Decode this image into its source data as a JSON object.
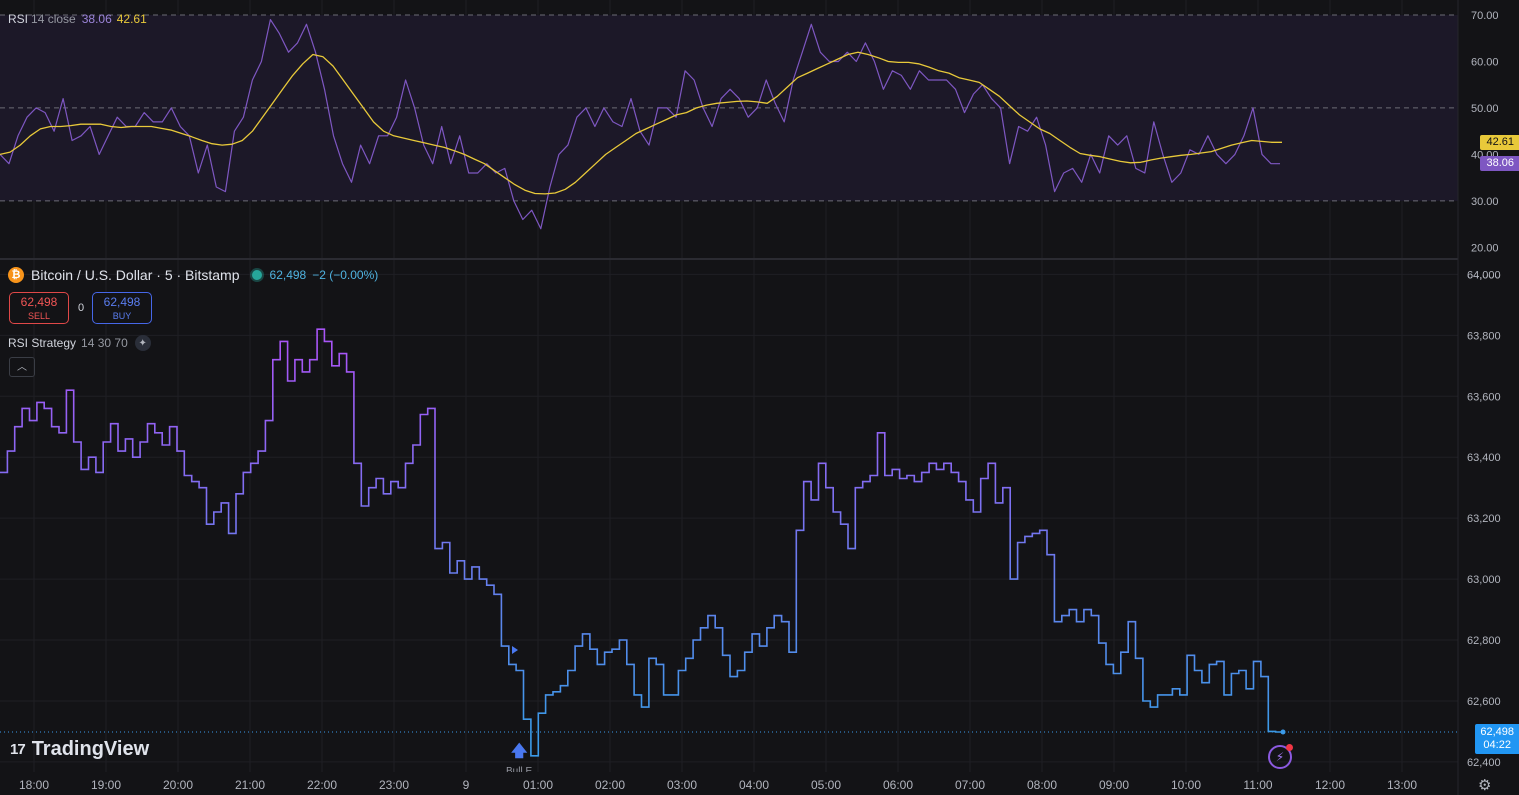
{
  "rsi_legend": {
    "name": "RSI",
    "params": "14 close",
    "rsi_value": "38.06",
    "ma_value": "42.61"
  },
  "symbol": {
    "title": "Bitcoin / U.S. Dollar · 5 · Bitstamp",
    "price": "62,498",
    "change": "−2 (−0.00%)"
  },
  "trade": {
    "sell_price": "62,498",
    "sell_label": "SELL",
    "spread": "0",
    "buy_price": "62,498",
    "buy_label": "BUY"
  },
  "strategy": {
    "name": "RSI Strategy",
    "params": "14 30 70"
  },
  "brand": {
    "name": "TradingView",
    "logo_glyph": "17"
  },
  "signal": {
    "partial_label": "Bull E"
  },
  "price_label": {
    "price": "62,498",
    "countdown": "04:22"
  },
  "icons": {
    "btc": "bitcoin-icon",
    "collapse": "chevron-up-icon",
    "flash": "flash-icon",
    "settings": "gear-icon"
  },
  "colors": {
    "rsi_line": "#7e57c2",
    "rsi_ma": "#e8c93a",
    "price_high": "#a855f7",
    "price_low": "#3b9ae8",
    "rsi_band": "#1c1828"
  },
  "chart_data": [
    {
      "type": "line",
      "title": "RSI",
      "ylim": [
        17.5,
        71.5
      ],
      "ticks": [
        "70.00",
        "60.00",
        "50.00",
        "40.00",
        "30.00",
        "20.00"
      ],
      "bands": [
        30,
        50,
        70
      ],
      "series": [
        {
          "name": "RSI",
          "values": [
            40,
            38,
            44,
            48,
            50,
            49,
            45,
            52,
            43,
            44,
            46,
            40,
            44,
            48,
            46,
            46,
            49,
            47,
            47,
            50,
            46,
            44,
            36,
            42,
            33,
            32,
            45,
            48,
            56,
            60,
            69,
            66,
            62,
            64,
            68,
            62,
            54,
            44,
            38,
            34,
            42,
            38,
            44,
            44,
            48,
            56,
            50,
            42,
            38,
            46,
            38,
            44,
            36,
            36,
            38,
            36,
            37,
            30,
            26,
            28,
            24,
            33,
            40,
            42,
            48,
            50,
            46,
            50,
            47,
            46,
            52,
            45,
            42,
            50,
            50,
            48,
            58,
            56,
            50,
            46,
            52,
            54,
            52,
            48,
            50,
            56,
            51,
            47,
            56,
            62,
            68,
            62,
            60,
            60,
            62,
            60,
            64,
            60,
            54,
            58,
            57,
            54,
            58,
            56,
            56,
            56,
            54,
            49,
            53,
            55,
            52,
            50,
            38,
            46,
            45,
            48,
            42,
            32,
            36,
            37,
            34,
            40,
            36,
            44,
            42,
            44,
            37,
            36,
            47,
            40,
            34,
            36,
            41,
            40,
            44,
            40,
            38,
            40,
            44,
            50,
            40,
            38,
            38
          ]
        },
        {
          "name": "RSI-based MA",
          "values": [
            40,
            40.5,
            42,
            44,
            45.5,
            46,
            46,
            46.2,
            46.5,
            46.5,
            46.5,
            46,
            45.8,
            46,
            46,
            46,
            45.6,
            45.2,
            44.5,
            43.8,
            43,
            42.3,
            42,
            42.2,
            43,
            45,
            48,
            51,
            54,
            57,
            59.5,
            61.5,
            61,
            59,
            56,
            53,
            50,
            47,
            45,
            44,
            43.5,
            43,
            42.5,
            42,
            41.5,
            40.8,
            40,
            39,
            38,
            36.5,
            35,
            33.5,
            32.3,
            31.6,
            31.5,
            31.7,
            32.5,
            34,
            36,
            38,
            40,
            41.5,
            43,
            44.5,
            45.5,
            46.5,
            47.5,
            48.5,
            49,
            50,
            50.6,
            51,
            51.2,
            51.4,
            51.5,
            51.3,
            51,
            52.5,
            54.5,
            56.5,
            57.5,
            58.5,
            59.5,
            60.5,
            61.5,
            62,
            61.5,
            60.8,
            60,
            59.8,
            59.8,
            59.5,
            58.8,
            58,
            57.5,
            56.5,
            56,
            55.5,
            54,
            52.5,
            50.5,
            48.5,
            47,
            45.5,
            44.5,
            43,
            41.5,
            40.2,
            39.8,
            39.5,
            39,
            38.5,
            38.2,
            38.3,
            38.8,
            39.2,
            39.5,
            39.8,
            40,
            40.3,
            40.6,
            41.3,
            42,
            42.5,
            43,
            42.8,
            42.6,
            42.61
          ]
        }
      ]
    },
    {
      "type": "line",
      "title": "Bitcoin / U.S. Dollar · 5 · Bitstamp",
      "ylim": [
        62380,
        64080
      ],
      "ticks": [
        "64,000",
        "63,800",
        "63,600",
        "63,400",
        "63,200",
        "63,000",
        "62,800",
        "62,600",
        "62,400"
      ],
      "x_ticks": [
        "18:00",
        "19:00",
        "20:00",
        "21:00",
        "22:00",
        "23:00",
        "9",
        "01:00",
        "02:00",
        "03:00",
        "04:00",
        "05:00",
        "06:00",
        "07:00",
        "08:00",
        "09:00",
        "10:00",
        "11:00",
        "12:00",
        "13:00"
      ],
      "last_price": 62498,
      "series": [
        {
          "name": "BTCUSD",
          "values": [
            63350,
            63420,
            63500,
            63560,
            63520,
            63580,
            63560,
            63500,
            63480,
            63620,
            63450,
            63360,
            63400,
            63350,
            63450,
            63510,
            63420,
            63460,
            63400,
            63450,
            63510,
            63480,
            63440,
            63500,
            63420,
            63340,
            63320,
            63300,
            63180,
            63220,
            63250,
            63150,
            63280,
            63350,
            63380,
            63420,
            63520,
            63720,
            63780,
            63650,
            63720,
            63680,
            63720,
            63820,
            63780,
            63700,
            63740,
            63680,
            63380,
            63240,
            63300,
            63330,
            63280,
            63320,
            63300,
            63380,
            63440,
            63540,
            63560,
            63100,
            63120,
            63020,
            63060,
            63000,
            63040,
            63000,
            62980,
            62950,
            62780,
            62720,
            62700,
            62540,
            62420,
            62560,
            62620,
            62630,
            62650,
            62700,
            62780,
            62820,
            62770,
            62720,
            62760,
            62770,
            62800,
            62720,
            62620,
            62580,
            62740,
            62720,
            62620,
            62620,
            62700,
            62740,
            62800,
            62840,
            62880,
            62840,
            62750,
            62680,
            62700,
            62760,
            62820,
            62780,
            62840,
            62880,
            62860,
            62760,
            63160,
            63320,
            63260,
            63380,
            63300,
            63220,
            63180,
            63100,
            63300,
            63320,
            63340,
            63480,
            63340,
            63360,
            63330,
            63340,
            63320,
            63350,
            63380,
            63360,
            63380,
            63350,
            63320,
            63260,
            63220,
            63330,
            63380,
            63250,
            63300,
            63000,
            63120,
            63140,
            63150,
            63160,
            63080,
            62860,
            62880,
            62900,
            62860,
            62900,
            62880,
            62790,
            62720,
            62690,
            62760,
            62860,
            62740,
            62600,
            62580,
            62620,
            62620,
            62640,
            62620,
            62750,
            62700,
            62660,
            62720,
            62730,
            62620,
            62690,
            62700,
            62640,
            62730,
            62680,
            62500,
            62498,
            62498
          ]
        }
      ]
    }
  ]
}
